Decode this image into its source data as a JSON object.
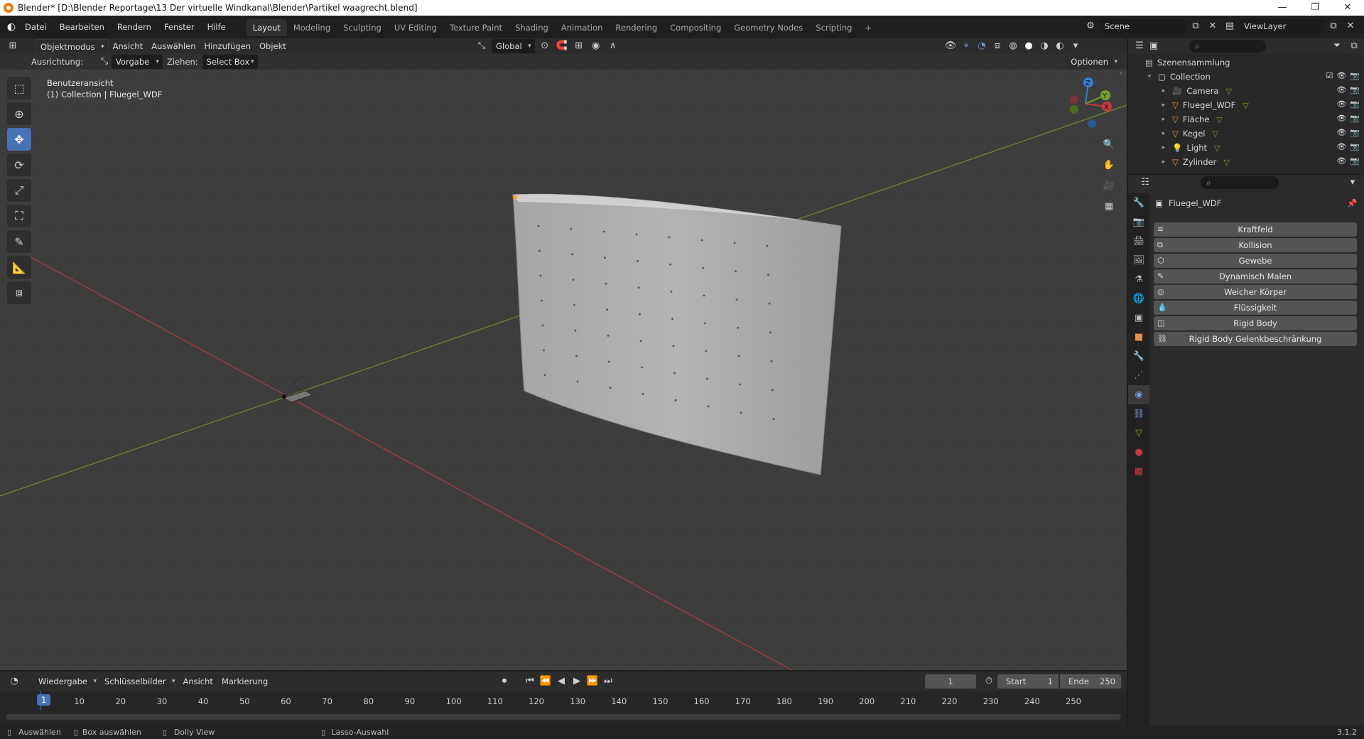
{
  "window": {
    "title": "Blender* [D:\\Blender Reportage\\13 Der virtuelle Windkanal\\Blender\\Partikel waagrecht.blend]",
    "controls": [
      "—",
      "❐",
      "✕"
    ]
  },
  "menu": {
    "items": [
      "Datei",
      "Bearbeiten",
      "Rendern",
      "Fenster",
      "Hilfe"
    ]
  },
  "workspaces": [
    "Layout",
    "Modeling",
    "Sculpting",
    "UV Editing",
    "Texture Paint",
    "Shading",
    "Animation",
    "Rendering",
    "Compositing",
    "Geometry Nodes",
    "Scripting",
    "+"
  ],
  "scene": {
    "label": "Scene",
    "viewlayer": "ViewLayer"
  },
  "header": {
    "mode": "Objektmodus",
    "menus": [
      "Ansicht",
      "Auswählen",
      "Hinzufügen",
      "Objekt"
    ],
    "orientation": "Global"
  },
  "tool_settings": {
    "ausrichtung_label": "Ausrichtung:",
    "ausrichtung_value": "Vorgabe",
    "ziehen_label": "Ziehen:",
    "ziehen_value": "Select Box",
    "optionen": "Optionen"
  },
  "viewport": {
    "view_name": "Benutzeransicht",
    "collection_info": "(1) Collection | Fluegel_WDF",
    "gizmo": {
      "x": "X",
      "y": "Y",
      "z": "Z"
    }
  },
  "outliner": {
    "root": "Szenensammlung",
    "collection": "Collection",
    "items": [
      {
        "name": "Camera",
        "type_icon": "camera-icon",
        "color": "#e8914a"
      },
      {
        "name": "Fluegel_WDF",
        "type_icon": "mesh-icon",
        "color": "#e8914a"
      },
      {
        "name": "Fläche",
        "type_icon": "mesh-icon",
        "color": "#e8914a"
      },
      {
        "name": "Kegel",
        "type_icon": "mesh-icon",
        "color": "#e8914a"
      },
      {
        "name": "Light",
        "type_icon": "light-icon",
        "color": "#e8914a"
      },
      {
        "name": "Zylinder",
        "type_icon": "mesh-icon",
        "color": "#e8914a"
      }
    ]
  },
  "properties": {
    "object_name": "Fluegel_WDF",
    "physics_buttons": [
      "Kraftfeld",
      "Kollision",
      "Gewebe",
      "Dynamisch Malen",
      "Weicher Körper",
      "Flüssigkeit",
      "Rigid Body",
      "Rigid Body Gelenkbeschränkung"
    ]
  },
  "timeline": {
    "menus": [
      "Wiedergabe",
      "Schlüsselbilder",
      "Ansicht",
      "Markierung"
    ],
    "current_frame": "1",
    "start_label": "Start",
    "start": "1",
    "end_label": "Ende",
    "end": "250",
    "ruler": [
      "1",
      "10",
      "20",
      "30",
      "40",
      "50",
      "60",
      "70",
      "80",
      "90",
      "100",
      "110",
      "120",
      "130",
      "140",
      "150",
      "160",
      "170",
      "180",
      "190",
      "200",
      "210",
      "220",
      "230",
      "240",
      "250"
    ]
  },
  "status": {
    "items": [
      "Auswählen",
      "Box auswählen",
      "Dolly View",
      "Lasso-Auswahl"
    ],
    "version": "3.1.2"
  },
  "colors": {
    "accent": "#4772b3",
    "x_axis": "#c8383d",
    "y_axis": "#76a32b",
    "z_axis": "#3b7fd4",
    "selected": "#ffa028"
  }
}
